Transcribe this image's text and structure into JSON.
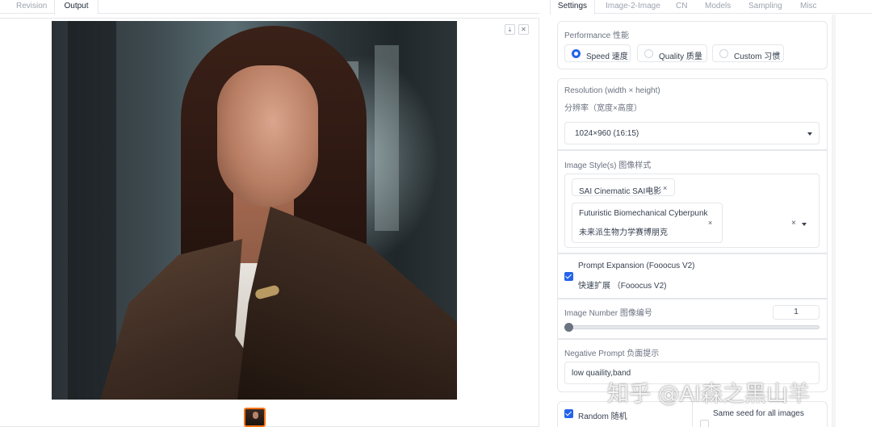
{
  "left_tabs": {
    "revision": "Revision",
    "output": "Output"
  },
  "gallery": {
    "download_icon": "download-icon",
    "close_icon": "close-icon"
  },
  "right_tabs": [
    "Settings",
    "Image-2-Image",
    "CN",
    "Models",
    "Sampling",
    "Misc"
  ],
  "performance": {
    "label": "Performance 性能",
    "options": [
      "Speed 速度",
      "Quality 质量",
      "Custom 习惯"
    ],
    "selected": "Speed 速度"
  },
  "resolution": {
    "label_line1": "Resolution (width × height)",
    "label_line2": "分辨率（宽度×高度）",
    "value": "1024×960 (16:15)"
  },
  "image_style": {
    "label": "Image Style(s) 图像样式",
    "chip1": "SAI Cinematic SAI电影",
    "chip2_line1": "Futuristic Biomechanical Cyberpunk",
    "chip2_line2": "未来派生物力学赛博朋克",
    "remove_symbol": "×"
  },
  "prompt_expansion": {
    "line1": "Prompt Expansion (Fooocus V2)",
    "line2": "快速扩展 （Fooocus V2)",
    "checked": true
  },
  "image_number": {
    "label": "Image Number 图像编号",
    "value": "1"
  },
  "negative_prompt": {
    "label": "Negative Prompt 负面提示",
    "value": "low quaility,band"
  },
  "random": {
    "label": "Random 随机",
    "checked": true,
    "same_seed_label": "Same seed for all images"
  },
  "watermark": "知乎 @AI森之黑山羊"
}
